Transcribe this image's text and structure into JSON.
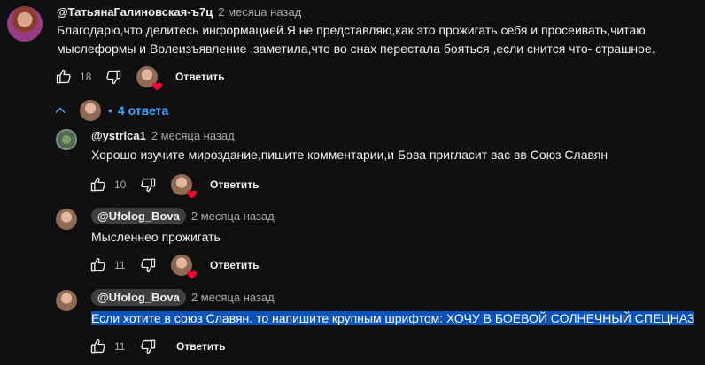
{
  "comments": [
    {
      "author": "@ТатьянаГалиновская-ъ7ц",
      "time": "2 месяца назад",
      "text_line1": "Благодарю,что делитесь информацией.Я не представляю,как это прожигать себя и просеивать,читаю",
      "text_line2": "мыслеформы и Волеизъявление  ,заметила,что во снах перестала бояться ,если снится что- страшное.",
      "likes": "18",
      "reply_label": "Ответить"
    }
  ],
  "replies_toggle": {
    "label": "4 ответа"
  },
  "replies": [
    {
      "author": "@ystrica1",
      "time": "2 месяца назад",
      "text": "Хорошо изучите мироздание,пишите комментарии,и Бова пригласит вас вв Союз Славян",
      "likes": "10",
      "reply_label": "Ответить"
    },
    {
      "author": "@Ufolog_Bova",
      "time": "2 месяца назад",
      "text": "Мысленнео прожигать",
      "likes": "11",
      "reply_label": "Ответить"
    },
    {
      "author": "@Ufolog_Bova",
      "time": "2 месяца назад",
      "text": "Если хотите в союз Славян. то напишите крупным шрифтом: ХОЧУ В БОЕВОЙ СОЛНЕЧНЫЙ СПЕЦНАЗ",
      "likes": "11",
      "reply_label": "Ответить"
    }
  ],
  "icons": {
    "like": "thumbs-up-icon",
    "dislike": "thumbs-down-icon",
    "heart": "heart-icon",
    "chevron": "chevron-up-icon"
  },
  "colors": {
    "background": "#0f0f0f",
    "link": "#3ea6ff",
    "heart": "#ff0033",
    "highlight": "#0a53b8"
  }
}
